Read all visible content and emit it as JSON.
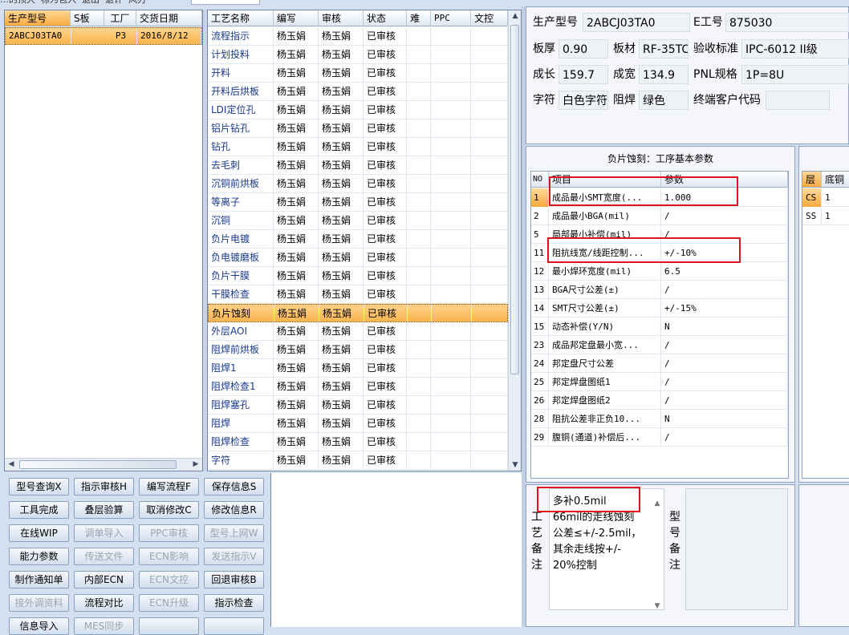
{
  "menu_text": "…的顶大 ·标为包入 ·退出 ·退计 ·风刃",
  "orders": {
    "headers": [
      "生产型号",
      "S板",
      "工厂",
      "交货日期"
    ],
    "rows": [
      {
        "model": "2ABCJ03TA0",
        "s": "",
        "factory": "P3",
        "date": "2016/8/12"
      }
    ]
  },
  "process": {
    "headers": [
      "工艺名称",
      "编写",
      "审核",
      "状态",
      "难",
      "PPC",
      "文控"
    ],
    "rows": [
      {
        "name": "流程指示",
        "writer": "杨玉娟",
        "reviewer": "杨玉娟",
        "status": "已审核"
      },
      {
        "name": "计划投料",
        "writer": "杨玉娟",
        "reviewer": "杨玉娟",
        "status": "已审核"
      },
      {
        "name": "开料",
        "writer": "杨玉娟",
        "reviewer": "杨玉娟",
        "status": "已审核"
      },
      {
        "name": "开料后烘板",
        "writer": "杨玉娟",
        "reviewer": "杨玉娟",
        "status": "已审核"
      },
      {
        "name": "LDI定位孔",
        "writer": "杨玉娟",
        "reviewer": "杨玉娟",
        "status": "已审核"
      },
      {
        "name": "铝片钻孔",
        "writer": "杨玉娟",
        "reviewer": "杨玉娟",
        "status": "已审核"
      },
      {
        "name": "钻孔",
        "writer": "杨玉娟",
        "reviewer": "杨玉娟",
        "status": "已审核"
      },
      {
        "name": "去毛刺",
        "writer": "杨玉娟",
        "reviewer": "杨玉娟",
        "status": "已审核"
      },
      {
        "name": "沉铜前烘板",
        "writer": "杨玉娟",
        "reviewer": "杨玉娟",
        "status": "已审核"
      },
      {
        "name": "等离子",
        "writer": "杨玉娟",
        "reviewer": "杨玉娟",
        "status": "已审核"
      },
      {
        "name": "沉铜",
        "writer": "杨玉娟",
        "reviewer": "杨玉娟",
        "status": "已审核"
      },
      {
        "name": "负片电镀",
        "writer": "杨玉娟",
        "reviewer": "杨玉娟",
        "status": "已审核"
      },
      {
        "name": "负电镀磨板",
        "writer": "杨玉娟",
        "reviewer": "杨玉娟",
        "status": "已审核"
      },
      {
        "name": "负片干膜",
        "writer": "杨玉娟",
        "reviewer": "杨玉娟",
        "status": "已审核"
      },
      {
        "name": "干膜检查",
        "writer": "杨玉娟",
        "reviewer": "杨玉娟",
        "status": "已审核"
      },
      {
        "name": "负片蚀刻",
        "writer": "杨玉娟",
        "reviewer": "杨玉娟",
        "status": "已审核"
      },
      {
        "name": "外层AOI",
        "writer": "杨玉娟",
        "reviewer": "杨玉娟",
        "status": "已审核"
      },
      {
        "name": "阻焊前烘板",
        "writer": "杨玉娟",
        "reviewer": "杨玉娟",
        "status": "已审核"
      },
      {
        "name": "阻焊1",
        "writer": "杨玉娟",
        "reviewer": "杨玉娟",
        "status": "已审核"
      },
      {
        "name": "阻焊检查1",
        "writer": "杨玉娟",
        "reviewer": "杨玉娟",
        "status": "已审核"
      },
      {
        "name": "阻焊塞孔",
        "writer": "杨玉娟",
        "reviewer": "杨玉娟",
        "status": "已审核"
      },
      {
        "name": "阻焊",
        "writer": "杨玉娟",
        "reviewer": "杨玉娟",
        "status": "已审核"
      },
      {
        "name": "阻焊检查",
        "writer": "杨玉娟",
        "reviewer": "杨玉娟",
        "status": "已审核"
      },
      {
        "name": "字符",
        "writer": "杨玉娟",
        "reviewer": "杨玉娟",
        "status": "已审核"
      }
    ]
  },
  "buttons": [
    {
      "label": "型号查询X",
      "enabled": true
    },
    {
      "label": "指示审核H",
      "enabled": true
    },
    {
      "label": "编写流程F",
      "enabled": true
    },
    {
      "label": "保存信息S",
      "enabled": true
    },
    {
      "label": "工具完成",
      "enabled": true
    },
    {
      "label": "叠层验算",
      "enabled": true
    },
    {
      "label": "取消修改C",
      "enabled": true
    },
    {
      "label": "修改信息R",
      "enabled": true
    },
    {
      "label": "在线WIP",
      "enabled": true
    },
    {
      "label": "调单导入",
      "enabled": false
    },
    {
      "label": "PPC审核",
      "enabled": false
    },
    {
      "label": "型号上网W",
      "enabled": false
    },
    {
      "label": "能力参数",
      "enabled": true
    },
    {
      "label": "传送文件",
      "enabled": false
    },
    {
      "label": "ECN影响",
      "enabled": false
    },
    {
      "label": "发送指示V",
      "enabled": false
    },
    {
      "label": "制作通知单",
      "enabled": true
    },
    {
      "label": "内部ECN",
      "enabled": true
    },
    {
      "label": "ECN文控",
      "enabled": false
    },
    {
      "label": "回退审核B",
      "enabled": true
    },
    {
      "label": "接外调资料",
      "enabled": false
    },
    {
      "label": "流程对比",
      "enabled": true
    },
    {
      "label": "ECN升级",
      "enabled": false
    },
    {
      "label": "指示检查",
      "enabled": true
    },
    {
      "label": "信息导入",
      "enabled": true
    },
    {
      "label": "MES同步",
      "enabled": false
    },
    {
      "label": "",
      "enabled": true
    },
    {
      "label": "",
      "enabled": true
    }
  ],
  "info": {
    "model_label": "生产型号",
    "model_value": "2ABCJ03TA0",
    "e_label": "E工号",
    "e_value": "875030",
    "thick_label": "板厚",
    "thick_value": "0.90",
    "mat_label": "板材",
    "mat_value": "RF-35TC",
    "std_label": "验收标准",
    "std_value": "IPC-6012 II级",
    "len_label": "成长",
    "len_value": "159.7",
    "wid_label": "成宽",
    "wid_value": "134.9",
    "pnl_label": "PNL规格",
    "pnl_value": "1P=8U",
    "char_label": "字符",
    "char_value": "白色字符",
    "mask_label": "阻焊",
    "mask_value": "绿色",
    "cust_label": "终端客户代码",
    "cust_value": ""
  },
  "params": {
    "title": "负片蚀刻：工序基本参数",
    "headers": [
      "NO",
      "项目",
      "参数"
    ],
    "rows": [
      {
        "no": "1",
        "item": "成品最小SMT宽度(...",
        "val": "1.000"
      },
      {
        "no": "2",
        "item": "成品最小BGA(mil)",
        "val": "/"
      },
      {
        "no": "5",
        "item": "局部最小补偿(mil)",
        "val": "/"
      },
      {
        "no": "11",
        "item": "阻抗线宽/线距控制...",
        "val": "+/-10%"
      },
      {
        "no": "12",
        "item": "最小焊环宽度(mil)",
        "val": "6.5"
      },
      {
        "no": "13",
        "item": "BGA尺寸公差(±)",
        "val": "/"
      },
      {
        "no": "14",
        "item": "SMT尺寸公差(±)",
        "val": "+/-15%"
      },
      {
        "no": "15",
        "item": "动态补偿(Y/N)",
        "val": "N"
      },
      {
        "no": "23",
        "item": "成品邦定盘最小宽...",
        "val": "/"
      },
      {
        "no": "24",
        "item": "邦定盘尺寸公差",
        "val": "/"
      },
      {
        "no": "25",
        "item": "邦定焊盘图纸1",
        "val": "/"
      },
      {
        "no": "26",
        "item": "邦定焊盘图纸2",
        "val": "/"
      },
      {
        "no": "28",
        "item": "阻抗公差非正负10...",
        "val": "N"
      },
      {
        "no": "29",
        "item": "腹铜(通道)补偿后...",
        "val": "/"
      }
    ]
  },
  "layers": {
    "headers": [
      "层",
      "底铜"
    ],
    "rows": [
      {
        "layer": "CS",
        "val": "1"
      },
      {
        "layer": "SS",
        "val": "1"
      }
    ]
  },
  "remarks": {
    "label": "工艺备注",
    "lines": [
      "多补0.5mil",
      "66mil的走线蚀刻",
      "公差≤+/-2.5mil，",
      "其余走线按+/-",
      "20%控制"
    ],
    "model_label": "型号备注"
  }
}
